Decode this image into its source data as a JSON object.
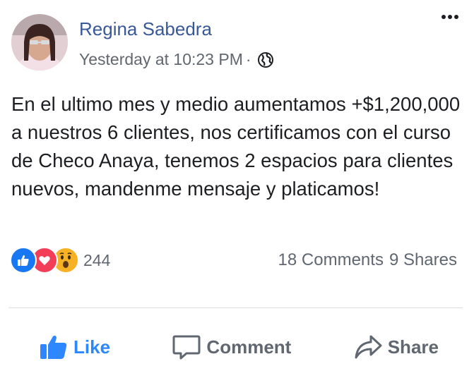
{
  "post": {
    "author": "Regina Sabedra",
    "timestamp": "Yesterday at 10:23 PM",
    "separator": "·",
    "privacy_icon": "globe-icon",
    "text": "En el ultimo mes y medio aumentamos +$1,200,000 a nuestros 6 clientes, nos certificamos con el curso de Checo Anaya, tenemos 2 espacios para clientes nuevos, mandenme mensaje y platicamos!"
  },
  "reactions": {
    "icons": [
      "like-reaction-icon",
      "love-reaction-icon",
      "wow-reaction-icon"
    ],
    "count": "244"
  },
  "stats": {
    "comments": "18 Comments",
    "shares": "9 Shares"
  },
  "actions": {
    "like": "Like",
    "comment": "Comment",
    "share": "Share"
  },
  "colors": {
    "author_link": "#385898",
    "like_active": "#2d88ff",
    "meta_text": "#616770",
    "divider": "#dadde1"
  }
}
